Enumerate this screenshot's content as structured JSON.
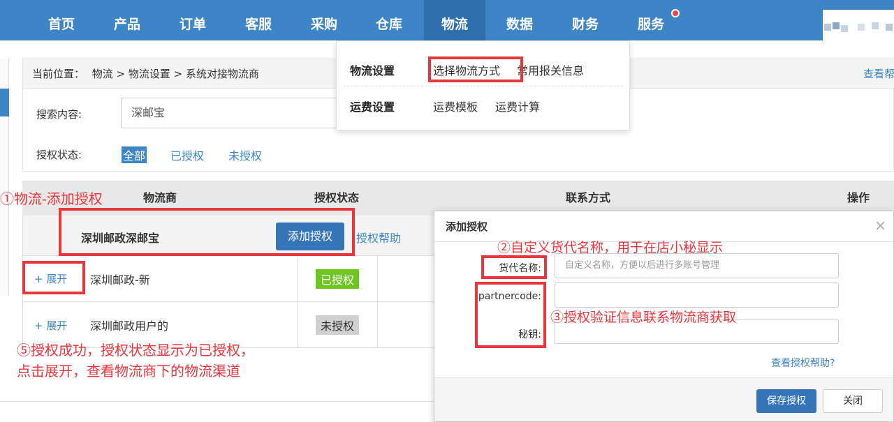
{
  "nav": {
    "items": [
      "首页",
      "产品",
      "订单",
      "客服",
      "采购",
      "仓库",
      "物流",
      "数据",
      "财务",
      "服务"
    ],
    "active": "物流"
  },
  "breadcrumb": {
    "label": "当前位置：",
    "path": "物流 > 物流设置 > 系统对接物流商",
    "help": "查看帮"
  },
  "search": {
    "label": "搜索内容:",
    "value": "深邮宝"
  },
  "filter": {
    "label": "授权状态:",
    "options": [
      "全部",
      "已授权",
      "未授权"
    ],
    "selected": "全部"
  },
  "dropdown": {
    "group1": {
      "title": "物流设置",
      "links": [
        "选择物流方式",
        "常用报关信息"
      ]
    },
    "group2": {
      "title": "运费设置",
      "links": [
        "运费模板",
        "运费计算"
      ]
    }
  },
  "table": {
    "headers": [
      "物流商",
      "授权状态",
      "联系方式",
      "操作"
    ],
    "group_row": {
      "name": "深圳邮政深邮宝",
      "button": "添加授权",
      "help": "授权帮助"
    },
    "rows": [
      {
        "expand": "+ 展开",
        "name": "深圳邮政-新",
        "status": "已授权"
      },
      {
        "expand": "+ 展开",
        "name": "深圳邮政用户的",
        "status": "未授权"
      }
    ]
  },
  "modal": {
    "title": "添加授权",
    "close": "×",
    "fields": [
      {
        "label": "货代名称:",
        "placeholder": "自定义名称，方便以后进行多账号管理"
      },
      {
        "label": "partnercode:",
        "placeholder": ""
      },
      {
        "label": "秘钥:",
        "placeholder": ""
      }
    ],
    "help": "查看授权帮助?",
    "save": "保存授权",
    "cancel": "关闭"
  },
  "annotations": {
    "a1": "①物流-添加授权",
    "a2": "②自定义货代名称，用于在店小秘显示",
    "a3": "③授权验证信息联系物流商获取",
    "a5_line1": "⑤授权成功，授权状态显示为已授权，",
    "a5_line2": "点击展开，查看物流商下的物流渠道"
  },
  "colors": {
    "nav_bg": "#3d85c6",
    "accent": "#3575b7",
    "annotation_red": "#e8363d",
    "authorized_green": "#6dc521"
  }
}
